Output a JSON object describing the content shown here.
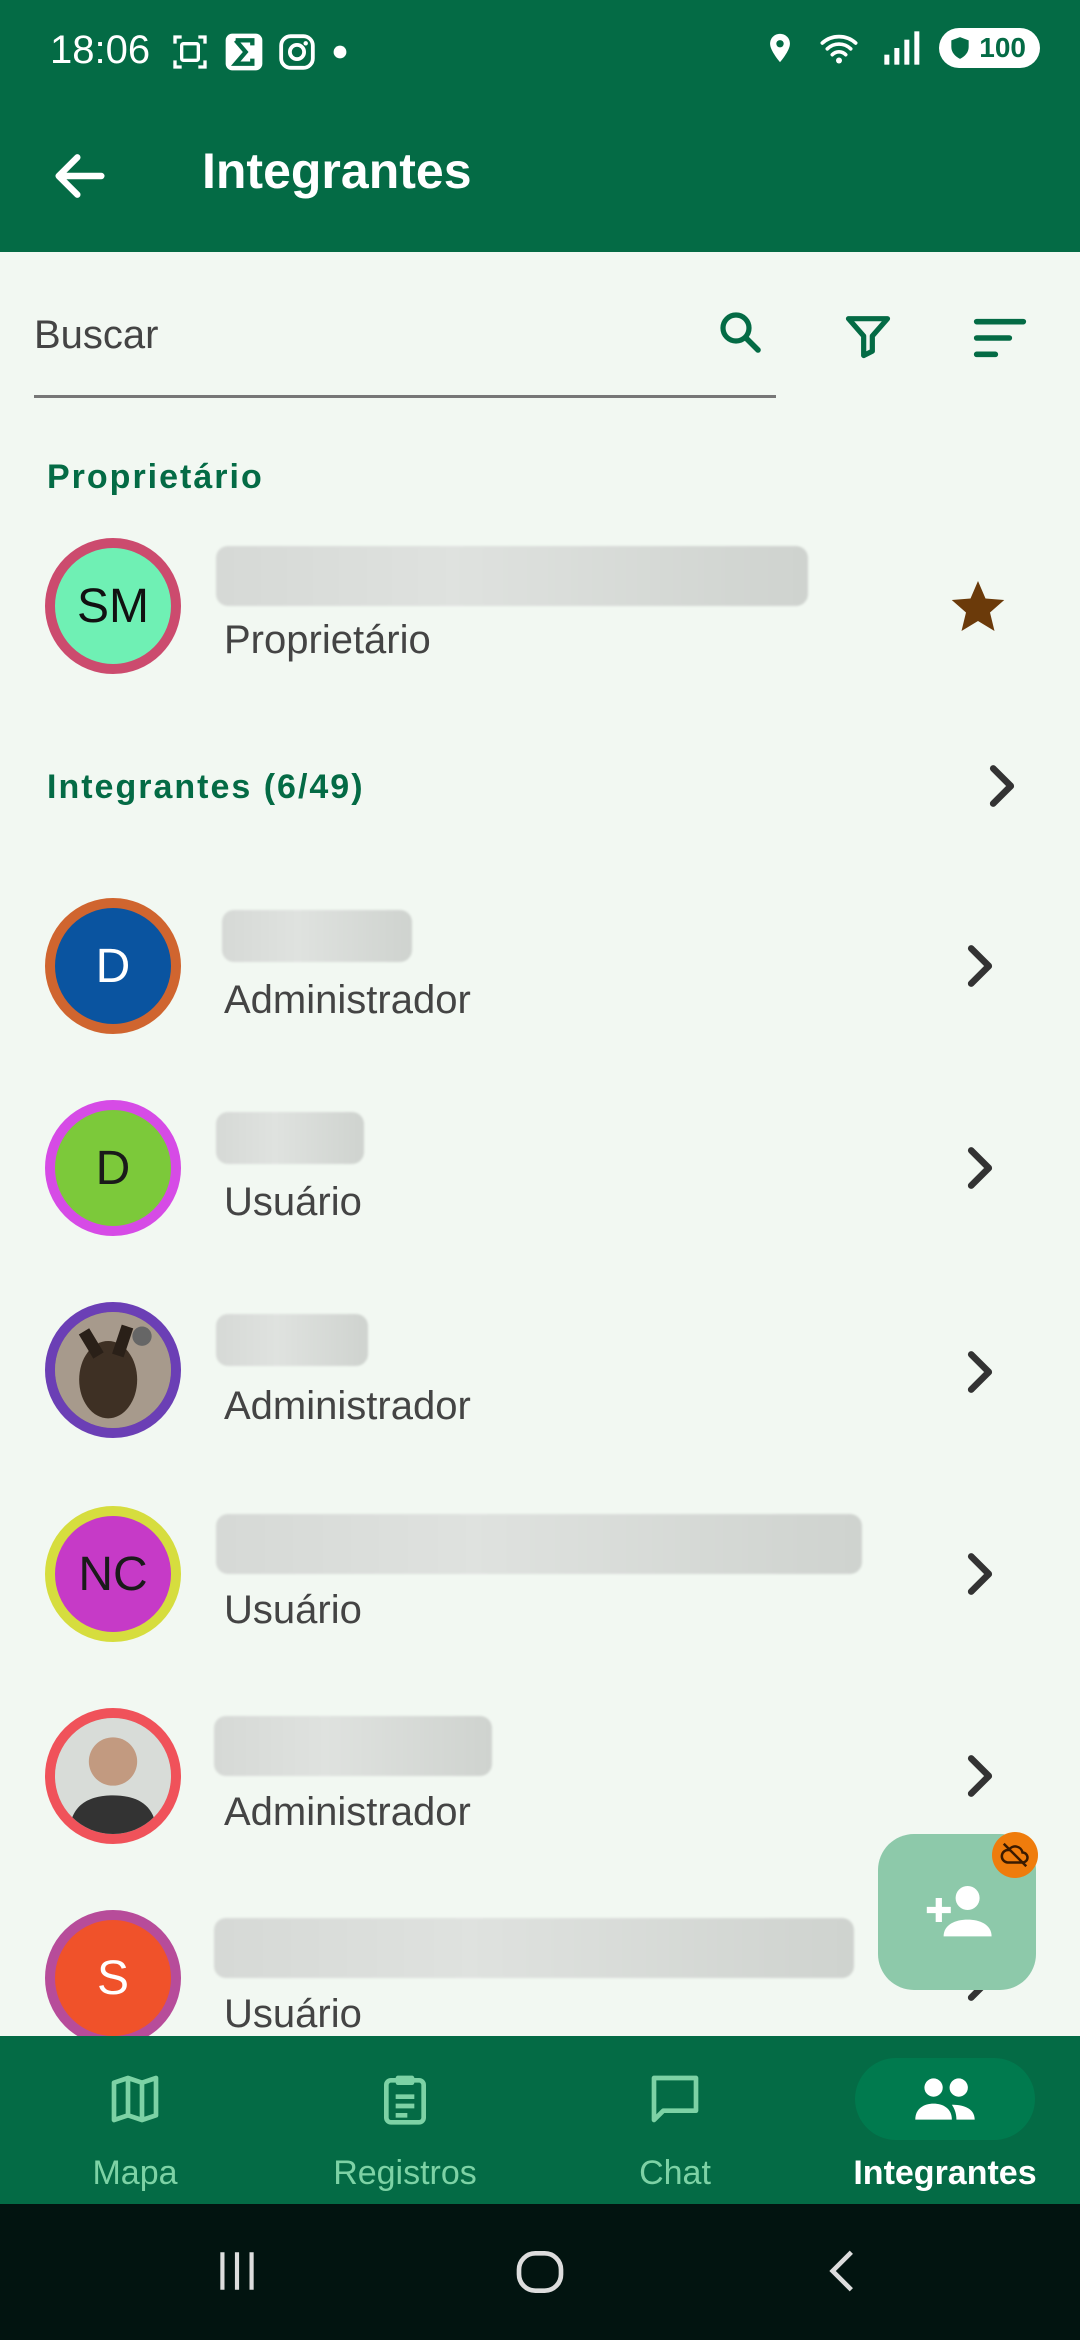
{
  "status_bar": {
    "time": "18:06",
    "battery": "100"
  },
  "app_bar": {
    "title": "Integrantes"
  },
  "search": {
    "placeholder": "Buscar"
  },
  "owner_section": {
    "label": "Proprietário",
    "owner": {
      "initials": "SM",
      "role": "Proprietário",
      "avatar_bg": "#6ff0b4",
      "avatar_border": "#cc4b6e"
    }
  },
  "members_section": {
    "label": "Integrantes (6/49)",
    "members": [
      {
        "initials": "D",
        "role": "Administrador",
        "avatar_bg": "#0a54a0",
        "avatar_border": "#d0652f",
        "initials_color": "#ffffff"
      },
      {
        "initials": "D",
        "role": "Usuário",
        "avatar_bg": "#7cc93a",
        "avatar_border": "#d64be6",
        "initials_color": "#1a1a1a"
      },
      {
        "initials": "",
        "role": "Administrador",
        "avatar_bg": "#8f7f70",
        "avatar_border": "#6b3fb5",
        "initials_color": "#ffffff"
      },
      {
        "initials": "NC",
        "role": "Usuário",
        "avatar_bg": "#c63ac7",
        "avatar_border": "#d6dd3e",
        "initials_color": "#1a1a1a"
      },
      {
        "initials": "",
        "role": "Administrador",
        "avatar_bg": "#b89c88",
        "avatar_border": "#f0525a",
        "initials_color": "#ffffff"
      },
      {
        "initials": "S",
        "role": "Usuário",
        "avatar_bg": "#f0522a",
        "avatar_border": "#b74c9a",
        "initials_color": "#ffffff"
      }
    ]
  },
  "bottom_nav": {
    "items": [
      {
        "label": "Mapa"
      },
      {
        "label": "Registros"
      },
      {
        "label": "Chat"
      },
      {
        "label": "Integrantes"
      }
    ],
    "active_index": 3
  },
  "colors": {
    "primary": "#046b45",
    "accent_text": "#7dd2a5",
    "star": "#6b3a0a"
  }
}
